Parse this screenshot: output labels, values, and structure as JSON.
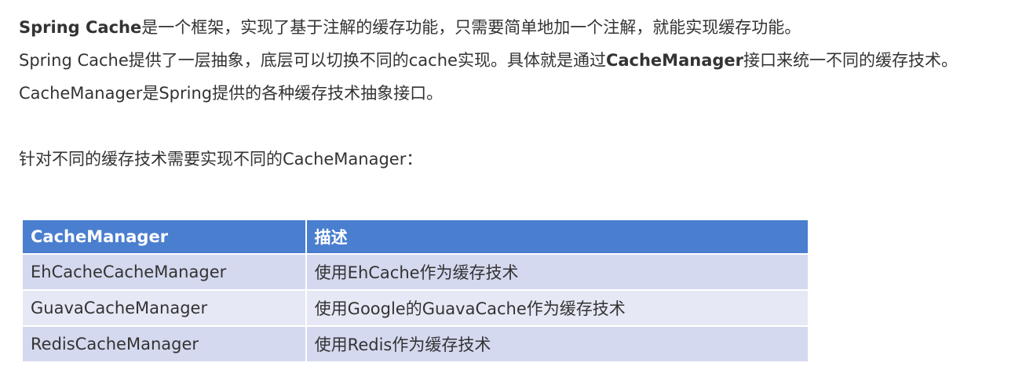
{
  "paragraphs": {
    "p1": {
      "bold_lead": "Spring Cache",
      "rest": "是一个框架，实现了基于注解的缓存功能，只需要简单地加一个注解，就能实现缓存功能。"
    },
    "p2": {
      "before": "Spring Cache提供了一层抽象，底层可以切换不同的cache实现。具体就是通过",
      "bold": "CacheManager",
      "after": "接口来统一不同的缓存技术。"
    },
    "p3": "CacheManager是Spring提供的各种缓存技术抽象接口。",
    "p4": "针对不同的缓存技术需要实现不同的CacheManager："
  },
  "table": {
    "headers": [
      "CacheManager",
      "描述"
    ],
    "rows": [
      [
        "EhCacheCacheManager",
        "使用EhCache作为缓存技术"
      ],
      [
        "GuavaCacheManager",
        "使用Google的GuavaCache作为缓存技术"
      ],
      [
        "RedisCacheManager",
        "使用Redis作为缓存技术"
      ]
    ]
  },
  "colors": {
    "header_bg": "#4a7ecf",
    "row_bg": "#d5d9ef",
    "text": "#333333"
  }
}
